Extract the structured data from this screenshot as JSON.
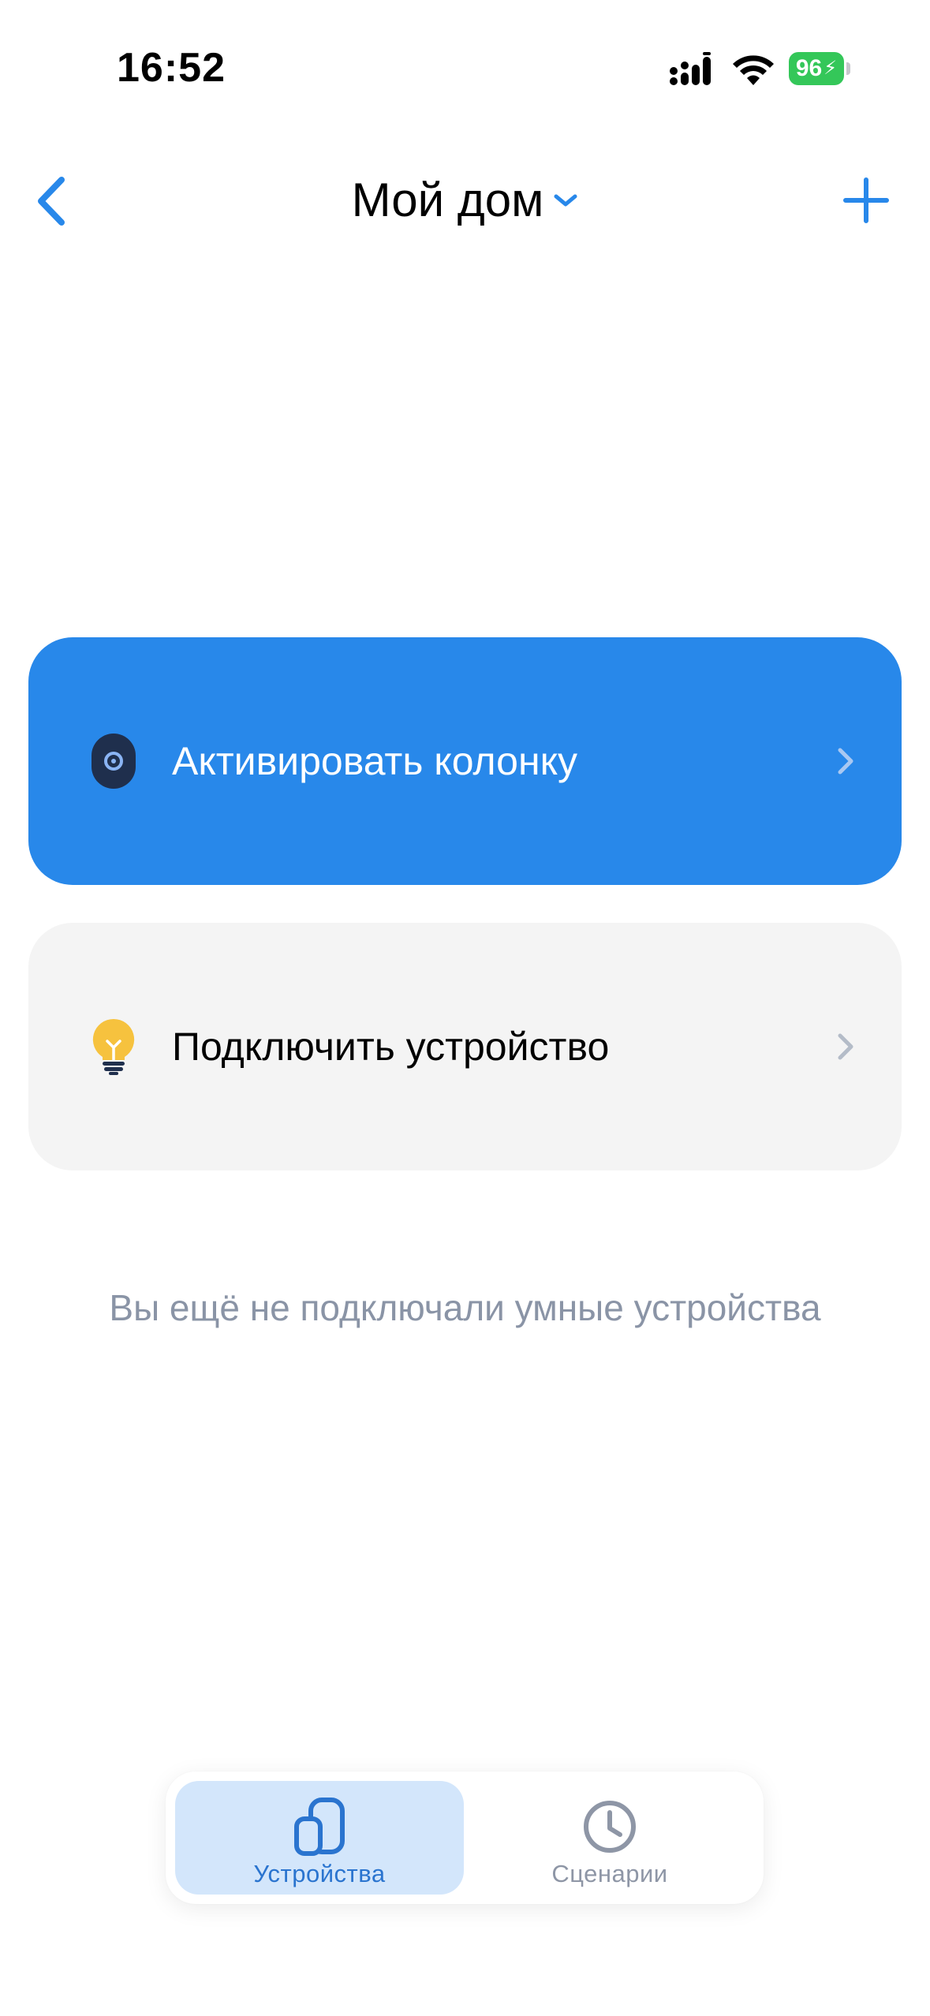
{
  "status_bar": {
    "time": "16:52",
    "battery": "96"
  },
  "nav": {
    "title": "Мой дом"
  },
  "cards": {
    "activate": {
      "label": "Активировать колонку",
      "icon": "speaker-icon"
    },
    "connect": {
      "label": "Подключить устройство",
      "icon": "lightbulb-icon"
    }
  },
  "empty_state": "Вы ещё не подключали умные устройства",
  "tabs": {
    "devices": {
      "label": "Устройства",
      "icon": "devices-icon",
      "active": true
    },
    "scenarios": {
      "label": "Сценарии",
      "icon": "clock-icon",
      "active": false
    }
  },
  "colors": {
    "accent": "#2888ea",
    "active_tab_bg": "#d3e6fb",
    "secondary_card_bg": "#f4f4f4",
    "muted_text": "#8a94a6",
    "battery_green": "#34c759"
  }
}
